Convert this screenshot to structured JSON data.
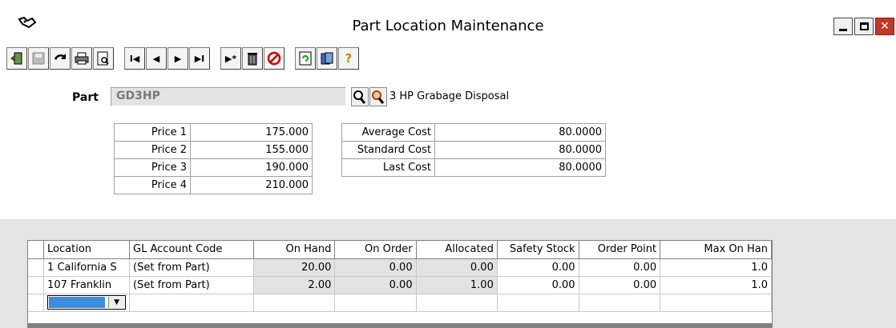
{
  "window": {
    "title": "Part Location Maintenance",
    "icon": "app-icon",
    "controls": [
      "minimize-icon",
      "maximize-icon",
      "close-icon"
    ]
  },
  "toolbar": {
    "buttons": [
      {
        "name": "exit-button",
        "icon": "exit-icon"
      },
      {
        "name": "save-button",
        "icon": "save-icon"
      },
      {
        "name": "undo-button",
        "icon": "undo-icon"
      },
      {
        "name": "print-button",
        "icon": "print-icon"
      },
      {
        "name": "preview-button",
        "icon": "preview-icon"
      },
      {
        "name": "first-record-button",
        "icon": "first-icon",
        "glyph": "I◀"
      },
      {
        "name": "prev-record-button",
        "icon": "prev-icon",
        "glyph": "◀"
      },
      {
        "name": "next-record-button",
        "icon": "next-icon",
        "glyph": "▶"
      },
      {
        "name": "last-record-button",
        "icon": "last-icon",
        "glyph": "▶I"
      },
      {
        "name": "new-record-button",
        "icon": "new-record-icon",
        "glyph": "▶*"
      },
      {
        "name": "delete-button",
        "icon": "trash-icon"
      },
      {
        "name": "cancel-button",
        "icon": "cancel-icon"
      },
      {
        "name": "refresh-button",
        "icon": "refresh-icon"
      },
      {
        "name": "book-button",
        "icon": "book-icon"
      },
      {
        "name": "help-button",
        "icon": "help-icon",
        "glyph": "?"
      }
    ]
  },
  "part": {
    "label": "Part",
    "value": "GD3HP",
    "description": "3 HP Grabage Disposal"
  },
  "prices": [
    {
      "label": "Price 1",
      "value": "175.000"
    },
    {
      "label": "Price 2",
      "value": "155.000"
    },
    {
      "label": "Price 3",
      "value": "190.000"
    },
    {
      "label": "Price 4",
      "value": "210.000"
    }
  ],
  "costs": [
    {
      "label": "Average Cost",
      "value": "80.0000"
    },
    {
      "label": "Standard Cost",
      "value": "80.0000"
    },
    {
      "label": "Last Cost",
      "value": "80.0000"
    }
  ],
  "grid": {
    "columns": [
      "Location",
      "GL Account Code",
      "On Hand",
      "On Order",
      "Allocated",
      "Safety Stock",
      "Order Point",
      "Max On Han"
    ],
    "rows": [
      [
        "1 California S",
        "(Set from Part)",
        "20.00",
        "0.00",
        "0.00",
        "0.00",
        "0.00",
        "1.0"
      ],
      [
        "107 Franklin",
        "(Set from Part)",
        "2.00",
        "0.00",
        "1.00",
        "0.00",
        "0.00",
        "1.0"
      ]
    ]
  }
}
